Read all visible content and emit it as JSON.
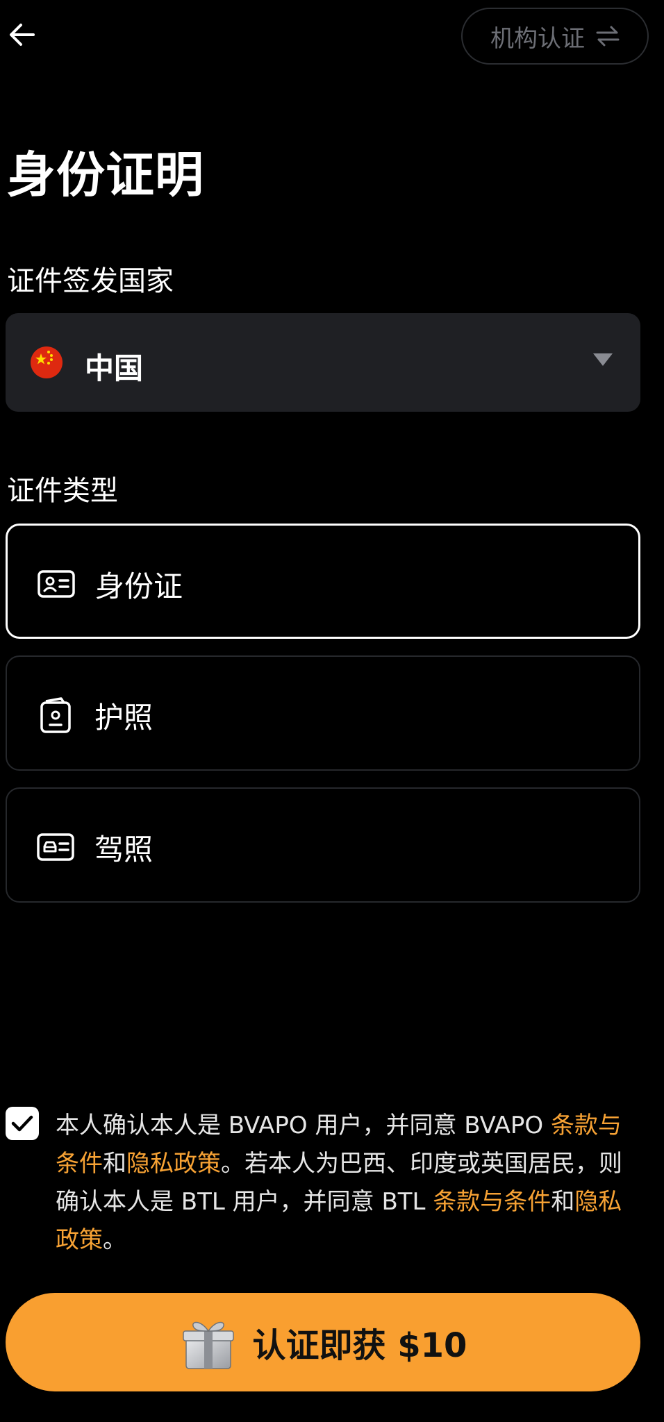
{
  "header": {
    "back_icon": "arrow-left-icon",
    "institution_button_label": "机构认证",
    "switch_icon": "swap-arrows-icon"
  },
  "page": {
    "title": "身份证明"
  },
  "issuing_country": {
    "label": "证件签发国家",
    "selected_value": "中国",
    "flag_icon": "china-flag-icon",
    "dropdown_icon": "caret-down-icon"
  },
  "document_type": {
    "label": "证件类型",
    "options": [
      {
        "label": "身份证",
        "icon": "id-card-icon",
        "selected": true
      },
      {
        "label": "护照",
        "icon": "passport-icon",
        "selected": false
      },
      {
        "label": "驾照",
        "icon": "driver-license-icon",
        "selected": false
      }
    ]
  },
  "consent": {
    "checked": true,
    "part1": "本人确认本人是 BVAPO 用户，并同意 BVAPO ",
    "link1": "条款与条件",
    "and1": "和",
    "link2": "隐私政策",
    "part2": "。若本人为巴西、印度或英国居民，则确认本人是 BTL 用户，并同意 BTL ",
    "link3": "条款与条件",
    "and2": "和",
    "link4": "隐私政策",
    "end": "。"
  },
  "cta": {
    "label": "认证即获 $10",
    "icon": "gift-box-icon"
  },
  "colors": {
    "background": "#000000",
    "accent": "#f99f30",
    "link": "#f7a234",
    "field_bg": "#1f2024"
  }
}
